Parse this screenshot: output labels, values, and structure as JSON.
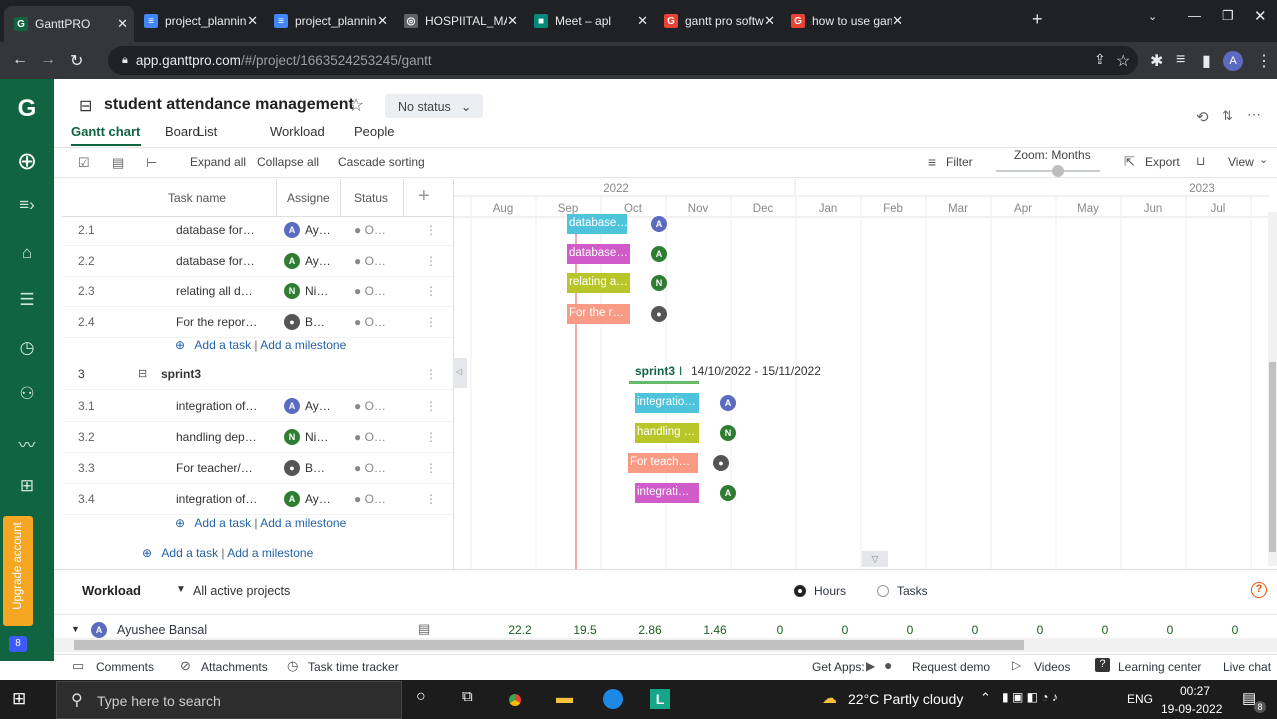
{
  "browser": {
    "tabs": [
      {
        "label": "GanttPRO",
        "fav": "G",
        "color": "#10643f"
      },
      {
        "label": "project_plannin",
        "fav": "≡",
        "color": "#4285f4"
      },
      {
        "label": "project_plannin",
        "fav": "≡",
        "color": "#4285f4"
      },
      {
        "label": "HOSPIITAL_MA",
        "fav": "◎",
        "color": "#5f6368"
      },
      {
        "label": "Meet – apl",
        "fav": "■",
        "color": "#00897b"
      },
      {
        "label": "gantt pro softw",
        "fav": "G",
        "color": "#ea4335"
      },
      {
        "label": "how to use gan",
        "fav": "G",
        "color": "#ea4335"
      }
    ],
    "url_host": "app.ganttpro.com",
    "url_path": "/#/project/1663524253245/gantt",
    "profile": "A"
  },
  "project": {
    "title": "student attendance management",
    "status": "No status",
    "nav": [
      "Gantt chart",
      "Board",
      "List",
      "Workload",
      "People"
    ]
  },
  "toolbar": {
    "expand": "Expand all",
    "collapse": "Collapse all",
    "cascade": "Cascade sorting",
    "filter": "Filter",
    "zoom": "Zoom: Months",
    "export": "Export",
    "view": "View"
  },
  "grid": {
    "headers": {
      "task": "Task name",
      "assignee": "Assigne",
      "status": "Status"
    },
    "rows": [
      {
        "num": "2.1",
        "name": "database for…",
        "av": "A",
        "avc": "#5c6bc0",
        "asg": "Ay…",
        "st": "● O…"
      },
      {
        "num": "2.2",
        "name": "database for…",
        "av": "A",
        "avc": "#2e7d32",
        "asg": "Ay…",
        "st": "● O…"
      },
      {
        "num": "2.3",
        "name": "relating all d…",
        "av": "N",
        "avc": "#2e7d32",
        "asg": "Ni…",
        "st": "● O…"
      },
      {
        "num": "2.4",
        "name": "For the repor…",
        "av": "●",
        "avc": "#555",
        "asg": "B…",
        "st": "● O…"
      }
    ],
    "add_task": "Add a task",
    "add_milestone": "Add a milestone",
    "sprint": {
      "num": "3",
      "name": "sprint3"
    },
    "rows2": [
      {
        "num": "3.1",
        "name": "integration of…",
        "av": "A",
        "avc": "#5c6bc0",
        "asg": "Ay…",
        "st": "● O…"
      },
      {
        "num": "3.2",
        "name": "handling dep…",
        "av": "N",
        "avc": "#2e7d32",
        "asg": "Ni…",
        "st": "● O…"
      },
      {
        "num": "3.3",
        "name": "For teacher/…",
        "av": "●",
        "avc": "#555",
        "asg": "B…",
        "st": "● O…"
      },
      {
        "num": "3.4",
        "name": "integration of…",
        "av": "A",
        "avc": "#2e7d32",
        "asg": "Ay…",
        "st": "● O…"
      }
    ]
  },
  "timeline": {
    "years": [
      "2022",
      "2023"
    ],
    "months": [
      "Aug",
      "Sep",
      "Oct",
      "Nov",
      "Dec",
      "Jan",
      "Feb",
      "Mar",
      "Apr",
      "May",
      "Jun",
      "Jul"
    ],
    "bars1": [
      {
        "label": "database…",
        "color": "#4dc3dc"
      },
      {
        "label": "database…",
        "color": "#d15bc9"
      },
      {
        "label": "relating a…",
        "color": "#b8c62a"
      },
      {
        "label": "For the r…",
        "color": "#f99a84"
      }
    ],
    "sprint_label": "sprint3",
    "sprint_dates": "14/10/2022 - 15/11/2022",
    "bars2": [
      {
        "label": "integratio…",
        "color": "#4dc3dc"
      },
      {
        "label": "handling …",
        "color": "#b8c62a"
      },
      {
        "label": "For teach…",
        "color": "#f99a84"
      },
      {
        "label": "integrati…",
        "color": "#d15bc9"
      }
    ]
  },
  "workload": {
    "title": "Workload",
    "scope": "All active projects",
    "opt_hours": "Hours",
    "opt_tasks": "Tasks",
    "person": "Ayushee Bansal",
    "values": [
      "22.2",
      "19.5",
      "2.86",
      "1.46",
      "0",
      "0",
      "0",
      "0",
      "0",
      "0",
      "0",
      "0"
    ]
  },
  "footer": {
    "comments": "Comments",
    "attachments": "Attachments",
    "tracker": "Task time tracker",
    "get_apps": "Get Apps:",
    "demo": "Request demo",
    "videos": "Videos",
    "learning": "Learning center",
    "chat": "Live chat"
  },
  "upgrade": "Upgrade account",
  "notif": "8",
  "taskbar": {
    "search": "Type here to search",
    "weather": "22°C  Partly cloudy",
    "lang": "ENG",
    "time": "00:27",
    "date": "19-09-2022",
    "notif": "8"
  }
}
